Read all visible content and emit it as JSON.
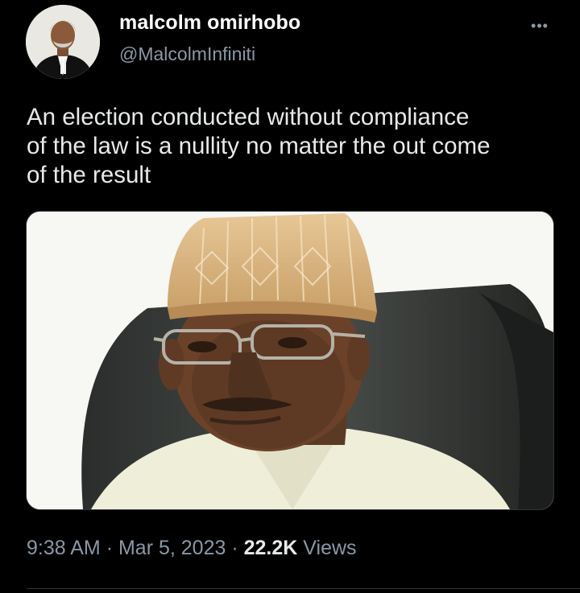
{
  "author": {
    "display_name": "malcolm omirhobo",
    "handle": "@MalcolmInfiniti"
  },
  "more_icon": "more-horizontal-icon",
  "tweet": {
    "text": "An election conducted without compliance\nof the law is a nullity no matter the  out come\nof the result"
  },
  "meta": {
    "time": "9:38 AM",
    "separator": "·",
    "date": "Mar 5, 2023",
    "views_count": "22.2K",
    "views_label": "Views"
  },
  "colors": {
    "background": "#000000",
    "text_primary": "#e7e9ea",
    "text_secondary": "#8b98a5",
    "border": "#2f3336"
  }
}
